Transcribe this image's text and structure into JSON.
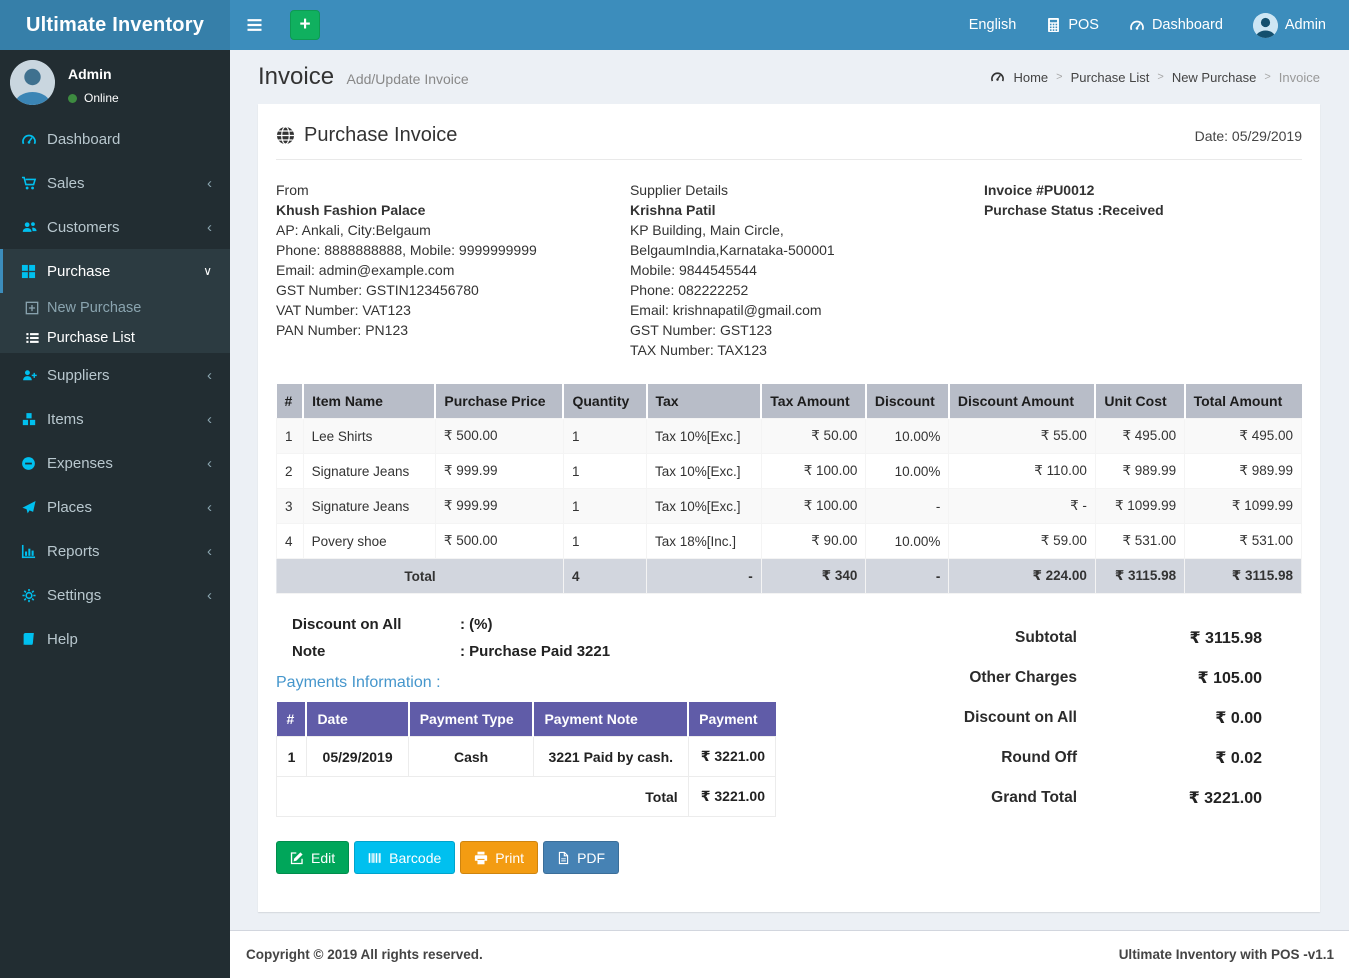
{
  "colors": {
    "theme_blue": "#3c8dbc",
    "logo_blue": "#367fa9",
    "sidebar_dark": "#222d32",
    "sidebar_icon_accent": "#00c0ef",
    "items_table_header": "#b8bdc8",
    "items_table_total_row": "#d2d6de",
    "payments_table_header": "#605ca8",
    "edit_button": "#00a65a",
    "barcode_button": "#00c0ef",
    "print_button": "#f39c12",
    "pdf_button": "#4682b4",
    "online_dot": "#3d8b40"
  },
  "icons": {
    "plus": "+",
    "chevron_collapsed": "‹",
    "chevron_expanded": "∨",
    "breadcrumb_separator": ">"
  },
  "navbar": {
    "brand": "Ultimate Inventory",
    "language": "English",
    "pos": "POS",
    "dashboard": "Dashboard",
    "user": "Admin"
  },
  "sidebar": {
    "user_name": "Admin",
    "user_status": "Online",
    "items": {
      "dashboard": "Dashboard",
      "sales": "Sales",
      "customers": "Customers",
      "purchase": "Purchase",
      "new_purchase": "New Purchase",
      "purchase_list": "Purchase List",
      "suppliers": "Suppliers",
      "items": "Items",
      "expenses": "Expenses",
      "places": "Places",
      "reports": "Reports",
      "settings": "Settings",
      "help": "Help"
    }
  },
  "page_header": {
    "title": "Invoice",
    "subtitle": "Add/Update Invoice",
    "breadcrumb": {
      "home": "Home",
      "purchase_list": "Purchase List",
      "new_purchase": "New Purchase",
      "current": "Invoice"
    }
  },
  "invoice": {
    "card_title": "Purchase Invoice",
    "date": "Date: 05/29/2019",
    "from": {
      "label": "From",
      "name": "Khush Fashion Palace",
      "address": "AP: Ankali, City:Belgaum",
      "phone": "Phone: 8888888888, Mobile: 9999999999",
      "email": "Email: admin@example.com",
      "gst": "GST Number: GSTIN123456780",
      "vat": "VAT Number: VAT123",
      "pan": "PAN Number: PN123"
    },
    "supplier": {
      "label": "Supplier Details",
      "name": "Krishna Patil",
      "address": "KP Building, Main Circle, BelgaumIndia,Karnataka-500001",
      "mobile": "Mobile: 9844545544",
      "phone": "Phone: 082222252",
      "email": "Email: krishnapatil@gmail.com",
      "gst": "GST Number: GST123",
      "tax": "TAX Number: TAX123"
    },
    "meta": {
      "invoice_no": "Invoice #PU0012",
      "status": "Purchase Status :Received"
    },
    "items_table": {
      "headers": [
        "#",
        "Item Name",
        "Purchase Price",
        "Quantity",
        "Tax",
        "Tax Amount",
        "Discount",
        "Discount Amount",
        "Unit Cost",
        "Total Amount"
      ],
      "rows": [
        [
          "1",
          "Lee Shirts",
          "₹ 500.00",
          "1",
          "Tax 10%[Exc.]",
          "₹ 50.00",
          "10.00%",
          "₹ 55.00",
          "₹ 495.00",
          "₹ 495.00"
        ],
        [
          "2",
          "Signature Jeans",
          "₹ 999.99",
          "1",
          "Tax 10%[Exc.]",
          "₹ 100.00",
          "10.00%",
          "₹ 110.00",
          "₹ 989.99",
          "₹ 989.99"
        ],
        [
          "3",
          "Signature Jeans",
          "₹ 999.99",
          "1",
          "Tax 10%[Exc.]",
          "₹ 100.00",
          "-",
          "₹ -",
          "₹ 1099.99",
          "₹ 1099.99"
        ],
        [
          "4",
          "Povery shoe",
          "₹ 500.00",
          "1",
          "Tax 18%[Inc.]",
          "₹ 90.00",
          "10.00%",
          "₹ 59.00",
          "₹ 531.00",
          "₹ 531.00"
        ]
      ],
      "total": {
        "label": "Total",
        "quantity": "4",
        "tax": "-",
        "tax_amount": "₹ 340",
        "discount": "-",
        "discount_amount": "₹ 224.00",
        "unit_cost": "₹ 3115.98",
        "total_amount": "₹ 3115.98"
      }
    },
    "discount_on_all": {
      "label": "Discount on All",
      "value": ": (%)"
    },
    "note": {
      "label": "Note",
      "value": ": Purchase Paid 3221"
    },
    "payments": {
      "title": "Payments Information :",
      "headers": [
        "#",
        "Date",
        "Payment Type",
        "Payment Note",
        "Payment"
      ],
      "rows": [
        [
          "1",
          "05/29/2019",
          "Cash",
          "3221 Paid by cash.",
          "₹ 3221.00"
        ]
      ],
      "total_label": "Total",
      "total_value": "₹ 3221.00"
    },
    "summary": [
      {
        "label": "Subtotal",
        "value": "₹ 3115.98"
      },
      {
        "label": "Other Charges",
        "value": "₹ 105.00"
      },
      {
        "label": "Discount on All",
        "value": "₹ 0.00"
      },
      {
        "label": "Round Off",
        "value": "₹ 0.02"
      },
      {
        "label": "Grand Total",
        "value": "₹ 3221.00"
      }
    ],
    "buttons": {
      "edit": "Edit",
      "barcode": "Barcode",
      "print": "Print",
      "pdf": "PDF"
    }
  },
  "footer": {
    "copyright": "Copyright © 2019 All rights reserved.",
    "version": "Ultimate Inventory with POS -v1.1"
  }
}
